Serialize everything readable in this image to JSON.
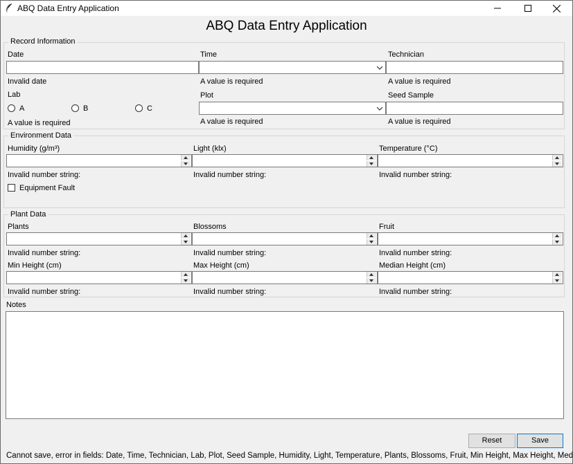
{
  "window": {
    "title": "ABQ Data Entry Application"
  },
  "app": {
    "title": "ABQ Data Entry Application"
  },
  "record": {
    "frame_label": "Record Information",
    "date": {
      "label": "Date",
      "value": "",
      "error": "Invalid date"
    },
    "time": {
      "label": "Time",
      "value": "",
      "error": "A value is required"
    },
    "technician": {
      "label": "Technician",
      "value": "",
      "error": "A value is required"
    },
    "lab": {
      "label": "Lab",
      "options": [
        "A",
        "B",
        "C"
      ],
      "error": "A value is required"
    },
    "plot": {
      "label": "Plot",
      "value": "",
      "error": "A value is required"
    },
    "seed_sample": {
      "label": "Seed Sample",
      "value": "",
      "error": "A value is required"
    }
  },
  "environment": {
    "frame_label": "Environment Data",
    "humidity": {
      "label": "Humidity (g/m³)",
      "value": "",
      "error": "Invalid number string:"
    },
    "light": {
      "label": "Light (klx)",
      "value": "",
      "error": "Invalid number string:"
    },
    "temperature": {
      "label": "Temperature (°C)",
      "value": "",
      "error": "Invalid number string:"
    },
    "equipment_fault": {
      "label": "Equipment Fault",
      "checked": false
    }
  },
  "plant": {
    "frame_label": "Plant Data",
    "plants": {
      "label": "Plants",
      "value": "",
      "error": "Invalid number string:"
    },
    "blossoms": {
      "label": "Blossoms",
      "value": "",
      "error": "Invalid number string:"
    },
    "fruit": {
      "label": "Fruit",
      "value": "",
      "error": "Invalid number string:"
    },
    "min_height": {
      "label": "Min Height (cm)",
      "value": "",
      "error": "Invalid number string:"
    },
    "max_height": {
      "label": "Max Height (cm)",
      "value": "",
      "error": "Invalid number string:"
    },
    "median_height": {
      "label": "Median Height (cm)",
      "value": "",
      "error": "Invalid number string:"
    }
  },
  "notes": {
    "label": "Notes",
    "value": ""
  },
  "buttons": {
    "reset": "Reset",
    "save": "Save"
  },
  "status": "Cannot save, error in fields: Date, Time, Technician, Lab, Plot, Seed Sample, Humidity, Light, Temperature, Plants, Blossoms, Fruit, Min Height, Max Height, Med Height"
}
